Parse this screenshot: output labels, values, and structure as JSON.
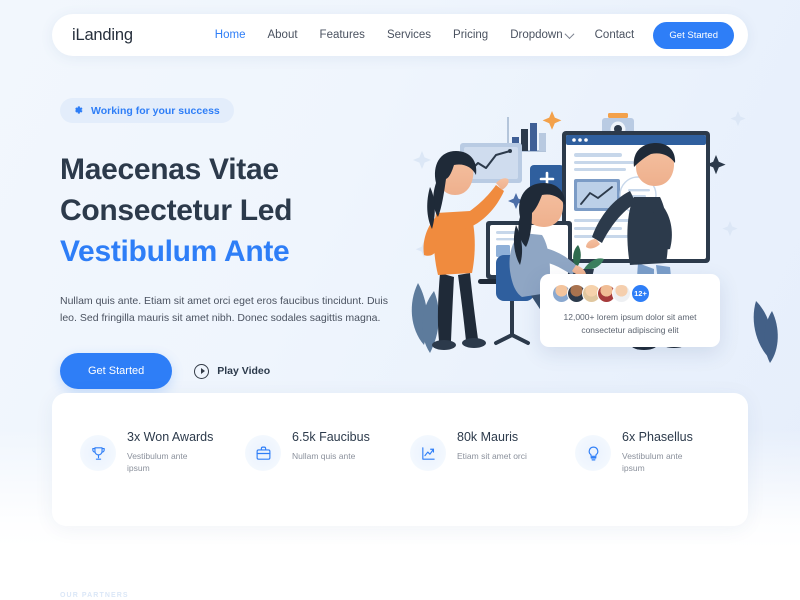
{
  "theme": {
    "accent": "#2e7ef7",
    "heading": "#2c3a4b",
    "body_text": "#4a5260",
    "muted": "#8b919c",
    "page_bg": "#f1f6fd",
    "card_bg": "#ffffff"
  },
  "navbar": {
    "logo": "iLanding",
    "links": [
      {
        "label": "Home",
        "active": true
      },
      {
        "label": "About",
        "active": false
      },
      {
        "label": "Features",
        "active": false
      },
      {
        "label": "Services",
        "active": false
      },
      {
        "label": "Pricing",
        "active": false
      },
      {
        "label": "Dropdown",
        "active": false,
        "has_chevron": true
      },
      {
        "label": "Contact",
        "active": false
      }
    ],
    "cta_label": "Get Started"
  },
  "hero": {
    "badge": {
      "icon": "gear-icon",
      "label": "Working for your success"
    },
    "title_line1": "Maecenas Vitae",
    "title_line2": "Consectetur Led",
    "title_line3": "Vestibulum Ante",
    "description": "Nullam quis ante. Etiam sit amet orci eget eros faucibus tincidunt. Duis leo. Sed fringilla mauris sit amet nibh. Donec sodales sagittis magna.",
    "primary_cta": "Get Started",
    "play_label": "Play Video"
  },
  "testimonial": {
    "avatar_count": 5,
    "badge": "12+",
    "text": "12,000+ lorem ipsum dolor sit amet consectetur adipiscing elit"
  },
  "stats": [
    {
      "icon": "trophy-icon",
      "value": "3x Won Awards",
      "label": "Vestibulum ante ipsum"
    },
    {
      "icon": "briefcase-icon",
      "value": "6.5k Faucibus",
      "label": "Nullam quis ante"
    },
    {
      "icon": "chart-line-icon",
      "value": "80k Mauris",
      "label": "Etiam sit amet orci"
    },
    {
      "icon": "lightbulb-icon",
      "value": "6x Phasellus",
      "label": "Vestibulum ante ipsum"
    }
  ],
  "partners": {
    "eyebrow": "OUR PARTNERS"
  }
}
